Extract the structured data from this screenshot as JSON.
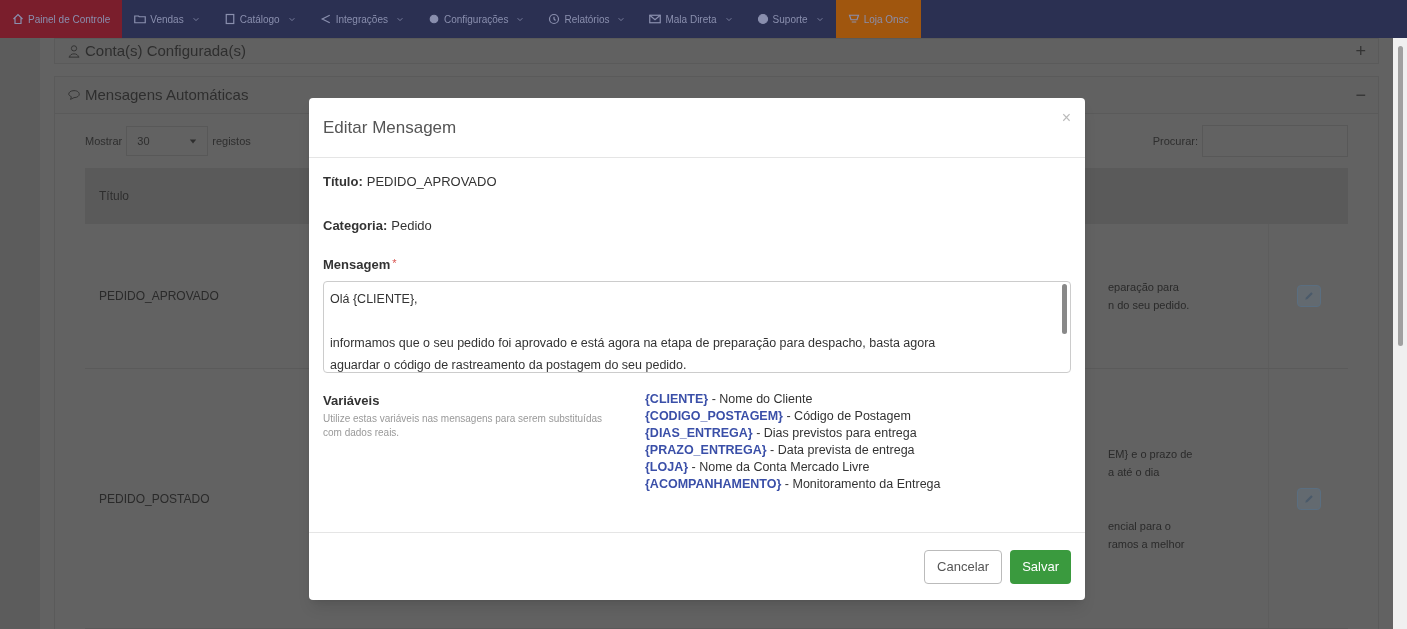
{
  "navbar": {
    "items": [
      {
        "label": "Painel de Controle",
        "dropdown": false,
        "color": "#7a1e2c"
      },
      {
        "label": "Vendas",
        "dropdown": true,
        "color": "#2b3052"
      },
      {
        "label": "Catálogo",
        "dropdown": true,
        "color": "#2b3052"
      },
      {
        "label": "Integrações",
        "dropdown": true,
        "color": "#2b3052"
      },
      {
        "label": "Configurações",
        "dropdown": true,
        "color": "#2b3052"
      },
      {
        "label": "Relatórios",
        "dropdown": true,
        "color": "#2b3052"
      },
      {
        "label": "Mala Direta",
        "dropdown": true,
        "color": "#2b3052"
      },
      {
        "label": "Suporte",
        "dropdown": true,
        "color": "#2b3052"
      },
      {
        "label": "Loja Onsc",
        "dropdown": false,
        "color": "#a0560e"
      }
    ]
  },
  "panels": [
    {
      "title": "Conta(s) Configurada(s)",
      "toggle": "+"
    },
    {
      "title": "Mensagens Automáticas",
      "toggle": "−"
    }
  ],
  "table_controls": {
    "show_label": "Mostrar",
    "page_size": "30",
    "suffix": "registos",
    "search_label": "Procurar:"
  },
  "table": {
    "columns": [
      "Título"
    ],
    "rows": [
      {
        "title": "PEDIDO_APROVADO",
        "message_fragments": [
          [
            "eparação para",
            "n do seu pedido."
          ]
        ]
      },
      {
        "title": "PEDIDO_POSTADO",
        "message_fragments": [
          [
            "EM} e o prazo de",
            "a até o dia"
          ],
          [
            "encial para o",
            "ramos a melhor"
          ]
        ]
      }
    ]
  },
  "modal": {
    "title": "Editar Mensagem",
    "close": "×",
    "fields": [
      {
        "label": "Título:",
        "value": "PEDIDO_APROVADO"
      },
      {
        "label": "Categoria:",
        "value": "Pedido"
      }
    ],
    "message": {
      "label": "Mensagem",
      "required_mark": "*",
      "paragraphs": [
        [
          "Olá {CLIENTE},"
        ],
        [
          "informamos que o seu pedido foi aprovado e está agora na etapa de preparação para despacho, basta agora",
          "aguardar o código de rastreamento da postagem do seu pedido."
        ]
      ]
    },
    "variables": {
      "title": "Variáveis",
      "help": "Utilize estas variáveis nas mensagens para serem substituídas com dados reais.",
      "items": [
        {
          "name": "{CLIENTE}",
          "description": "- Nome do Cliente"
        },
        {
          "name": "{CODIGO_POSTAGEM}",
          "description": "- Código de Postagem"
        },
        {
          "name": "{DIAS_ENTREGA}",
          "description": "- Dias previstos para entrega"
        },
        {
          "name": "{PRAZO_ENTREGA}",
          "description": "- Data prevista de entrega"
        },
        {
          "name": "{LOJA}",
          "description": "- Nome da Conta Mercado Livre"
        },
        {
          "name": "{ACOMPANHAMENTO}",
          "description": "- Monitoramento da Entrega"
        }
      ]
    },
    "buttons": [
      {
        "label": "Cancelar",
        "kind": "secondary"
      },
      {
        "label": "Salvar",
        "kind": "primary"
      }
    ]
  }
}
